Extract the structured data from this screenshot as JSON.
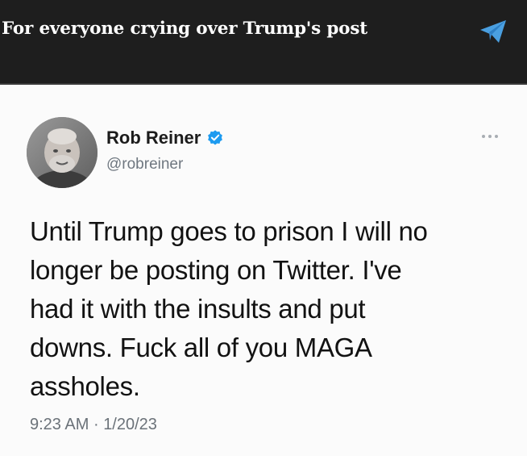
{
  "caption": {
    "text": "For everyone crying over Trump's post",
    "icon": "telegram-send-icon",
    "icon_color": "#4a9fe0"
  },
  "tweet": {
    "display_name": "Rob Reiner",
    "handle": "@robreiner",
    "verified": true,
    "verified_color": "#1d9bf0",
    "body_lines": [
      "Until Trump goes to prison I will no",
      "longer be posting on Twitter. I've",
      "had it with the insults and put",
      "downs. Fuck all of you MAGA",
      "assholes."
    ],
    "time": "9:23 AM",
    "separator": "·",
    "date": "1/20/23",
    "more_icon": "more-options-icon",
    "avatar_icon": "profile-avatar"
  },
  "colors": {
    "caption_bar": "#1e1e1e",
    "card_bg": "#fbfbfb",
    "text_primary": "#121212",
    "text_secondary": "#6f7780"
  }
}
